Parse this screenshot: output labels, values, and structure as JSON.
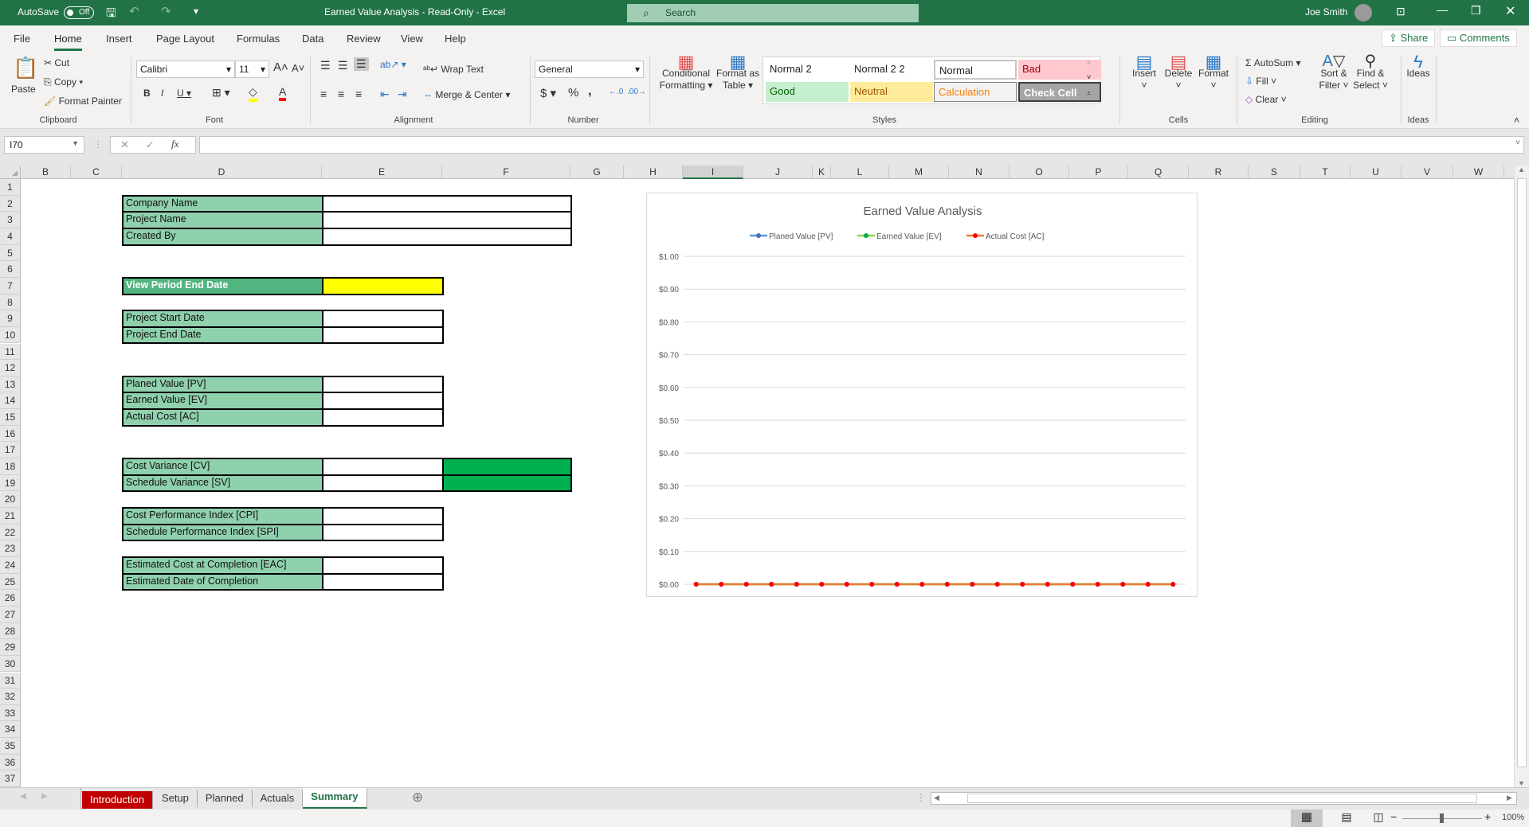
{
  "titlebar": {
    "autosave": "AutoSave",
    "autosave_state": "Off",
    "title": "Earned Value Analysis  -  Read-Only  -  Excel",
    "search": "Search",
    "user": "Joe Smith"
  },
  "ribbon_tabs": [
    "File",
    "Home",
    "Insert",
    "Page Layout",
    "Formulas",
    "Data",
    "Review",
    "View",
    "Help"
  ],
  "active_tab": "Home",
  "share": "Share",
  "comments": "Comments",
  "clipboard": {
    "paste": "Paste",
    "cut": "Cut",
    "copy": "Copy",
    "format_painter": "Format Painter",
    "label": "Clipboard"
  },
  "font": {
    "name": "Calibri",
    "size": "11",
    "label": "Font",
    "fill_color": "#ffff00",
    "font_color": "#ff0000"
  },
  "alignment": {
    "wrap": "Wrap Text",
    "merge": "Merge & Center",
    "label": "Alignment"
  },
  "number": {
    "format": "General",
    "label": "Number"
  },
  "styles": {
    "conditional": "Conditional",
    "formatting": "Formatting",
    "format_as": "Format as",
    "table": "Table",
    "label": "Styles",
    "items": [
      {
        "name": "Normal 2",
        "bg": "#ffffff",
        "fg": "#000000"
      },
      {
        "name": "Normal 2 2",
        "bg": "#ffffff",
        "fg": "#000000"
      },
      {
        "name": "Normal",
        "bg": "#ffffff",
        "fg": "#000000"
      },
      {
        "name": "Bad",
        "bg": "#ffc7ce",
        "fg": "#9c0006"
      },
      {
        "name": "Good",
        "bg": "#c6efce",
        "fg": "#006100"
      },
      {
        "name": "Neutral",
        "bg": "#ffeb9c",
        "fg": "#9c5700"
      },
      {
        "name": "Calculation",
        "bg": "#f2f2f2",
        "fg": "#fa7d00"
      },
      {
        "name": "Check Cell",
        "bg": "#a5a5a5",
        "fg": "#ffffff"
      }
    ]
  },
  "cells": {
    "insert": "Insert",
    "delete": "Delete",
    "format": "Format",
    "label": "Cells"
  },
  "editing": {
    "autosum": "AutoSum",
    "fill": "Fill",
    "clear": "Clear",
    "sort": "Sort &",
    "filter": "Filter",
    "find": "Find &",
    "select": "Select",
    "label": "Editing"
  },
  "ideas": {
    "ideas": "Ideas",
    "label": "Ideas"
  },
  "formula_bar": {
    "name_box": "I70",
    "fx": "fx",
    "value": ""
  },
  "columns": [
    "B",
    "C",
    "D",
    "E",
    "F",
    "G",
    "H",
    "I",
    "J",
    "K",
    "L",
    "M",
    "N",
    "O",
    "P",
    "Q",
    "R",
    "S",
    "T",
    "U",
    "V",
    "W"
  ],
  "rows": [
    "1",
    "2",
    "3",
    "4",
    "5",
    "6",
    "7",
    "8",
    "9",
    "10",
    "11",
    "12",
    "13",
    "14",
    "15",
    "16",
    "17",
    "18",
    "19",
    "20",
    "21",
    "22",
    "23",
    "24",
    "25",
    "26",
    "27",
    "28",
    "29",
    "30",
    "31",
    "32",
    "33",
    "34",
    "35",
    "36",
    "37"
  ],
  "sheet": {
    "blocks": [
      {
        "row": 2,
        "label": "Company Name",
        "value": "",
        "merged": true
      },
      {
        "row": 3,
        "label": "Project Name",
        "value": "",
        "merged": true
      },
      {
        "row": 4,
        "label": "Created By",
        "value": "",
        "merged": true
      },
      {
        "row": 7,
        "label": "View Period End Date",
        "value": "",
        "header": true,
        "value_bg": "#ffff00"
      },
      {
        "row": 9,
        "label": "Project Start Date",
        "value": ""
      },
      {
        "row": 10,
        "label": "Project End Date",
        "value": ""
      },
      {
        "row": 13,
        "label": "Planed Value [PV]",
        "value": ""
      },
      {
        "row": 14,
        "label": "Earned Value [EV]",
        "value": ""
      },
      {
        "row": 15,
        "label": "Actual Cost [AC]",
        "value": ""
      },
      {
        "row": 18,
        "label": "Cost Variance [CV]",
        "value": "",
        "status_bg": "#00b050"
      },
      {
        "row": 19,
        "label": "Schedule Variance [SV]",
        "value": "",
        "status_bg": "#00b050"
      },
      {
        "row": 21,
        "label": "Cost Performance Index [CPI]",
        "value": ""
      },
      {
        "row": 22,
        "label": "Schedule Performance Index [SPI]",
        "value": ""
      },
      {
        "row": 24,
        "label": "Estimated Cost at Completion [EAC]",
        "value": ""
      },
      {
        "row": 25,
        "label": "Estimated Date of Completion",
        "value": ""
      }
    ]
  },
  "chart_data": {
    "type": "line",
    "title": "Earned Value Analysis",
    "legend_position": "top",
    "grid": true,
    "ylim": [
      0,
      1
    ],
    "yticks": [
      "$1.00",
      "$0.90",
      "$0.80",
      "$0.70",
      "$0.60",
      "$0.50",
      "$0.40",
      "$0.30",
      "$0.20",
      "$0.10",
      "$0.00"
    ],
    "series": [
      {
        "name": "Planed Value [PV]",
        "color": "#5b9bd5",
        "marker": "#4472c4",
        "values": [
          0,
          0,
          0,
          0,
          0,
          0,
          0,
          0,
          0,
          0,
          0,
          0,
          0,
          0,
          0,
          0,
          0,
          0,
          0,
          0
        ]
      },
      {
        "name": "Earned Value [EV]",
        "color": "#92d050",
        "marker": "#00b050",
        "values": [
          0,
          0,
          0,
          0,
          0,
          0,
          0,
          0,
          0,
          0,
          0,
          0,
          0,
          0,
          0,
          0,
          0,
          0,
          0,
          0
        ]
      },
      {
        "name": "Actual Cost [AC]",
        "color": "#ed7d31",
        "marker": "#ff0000",
        "values": [
          0,
          0,
          0,
          0,
          0,
          0,
          0,
          0,
          0,
          0,
          0,
          0,
          0,
          0,
          0,
          0,
          0,
          0,
          0,
          0
        ]
      }
    ]
  },
  "sheet_tabs": [
    {
      "name": "Introduction",
      "bg": "#c00000"
    },
    {
      "name": "Setup"
    },
    {
      "name": "Planned"
    },
    {
      "name": "Actuals"
    },
    {
      "name": "Summary",
      "active": true
    }
  ],
  "status": {
    "zoom": "100%"
  }
}
